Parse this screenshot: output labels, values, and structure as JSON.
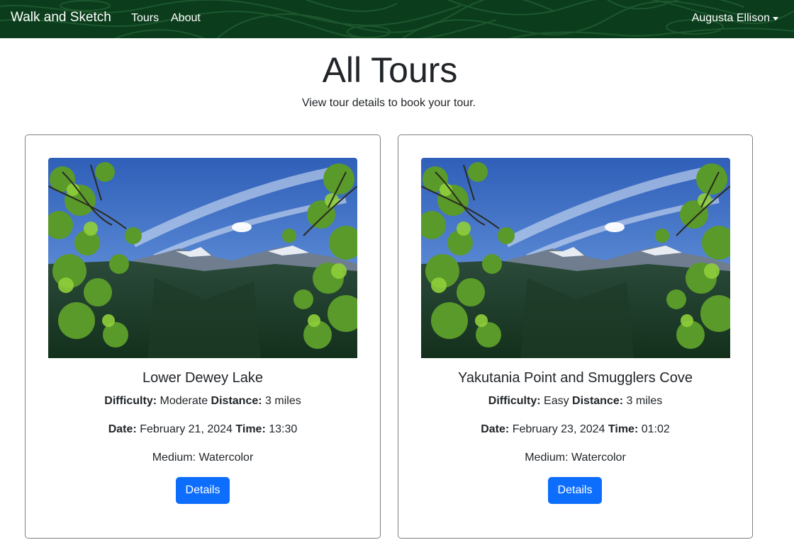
{
  "navbar": {
    "brand": "Walk and Sketch",
    "links": [
      {
        "label": "Tours"
      },
      {
        "label": "About"
      }
    ],
    "user": "Augusta Ellison",
    "colors": {
      "background": "#0b3d1c",
      "text": "#ffffff"
    }
  },
  "header": {
    "title": "All Tours",
    "subtitle": "View tour details to book your tour."
  },
  "tours": [
    {
      "title": "Lower Dewey Lake",
      "difficulty_label": "Difficulty:",
      "difficulty": "Moderate",
      "distance_label": "Distance:",
      "distance": "3 miles",
      "date_label": "Date:",
      "date": "February 21, 2024",
      "time_label": "Time:",
      "time": "13:30",
      "medium": "Medium: Watercolor",
      "button": "Details"
    },
    {
      "title": "Yakutania Point and Smugglers Cove",
      "difficulty_label": "Difficulty:",
      "difficulty": "Easy",
      "distance_label": "Distance:",
      "distance": "3 miles",
      "date_label": "Date:",
      "date": "February 23, 2024",
      "time_label": "Time:",
      "time": "01:02",
      "medium": "Medium: Watercolor",
      "button": "Details"
    }
  ],
  "colors": {
    "primary_button": "#0d6efd",
    "card_border": "#7d7f82",
    "text": "#212529"
  }
}
